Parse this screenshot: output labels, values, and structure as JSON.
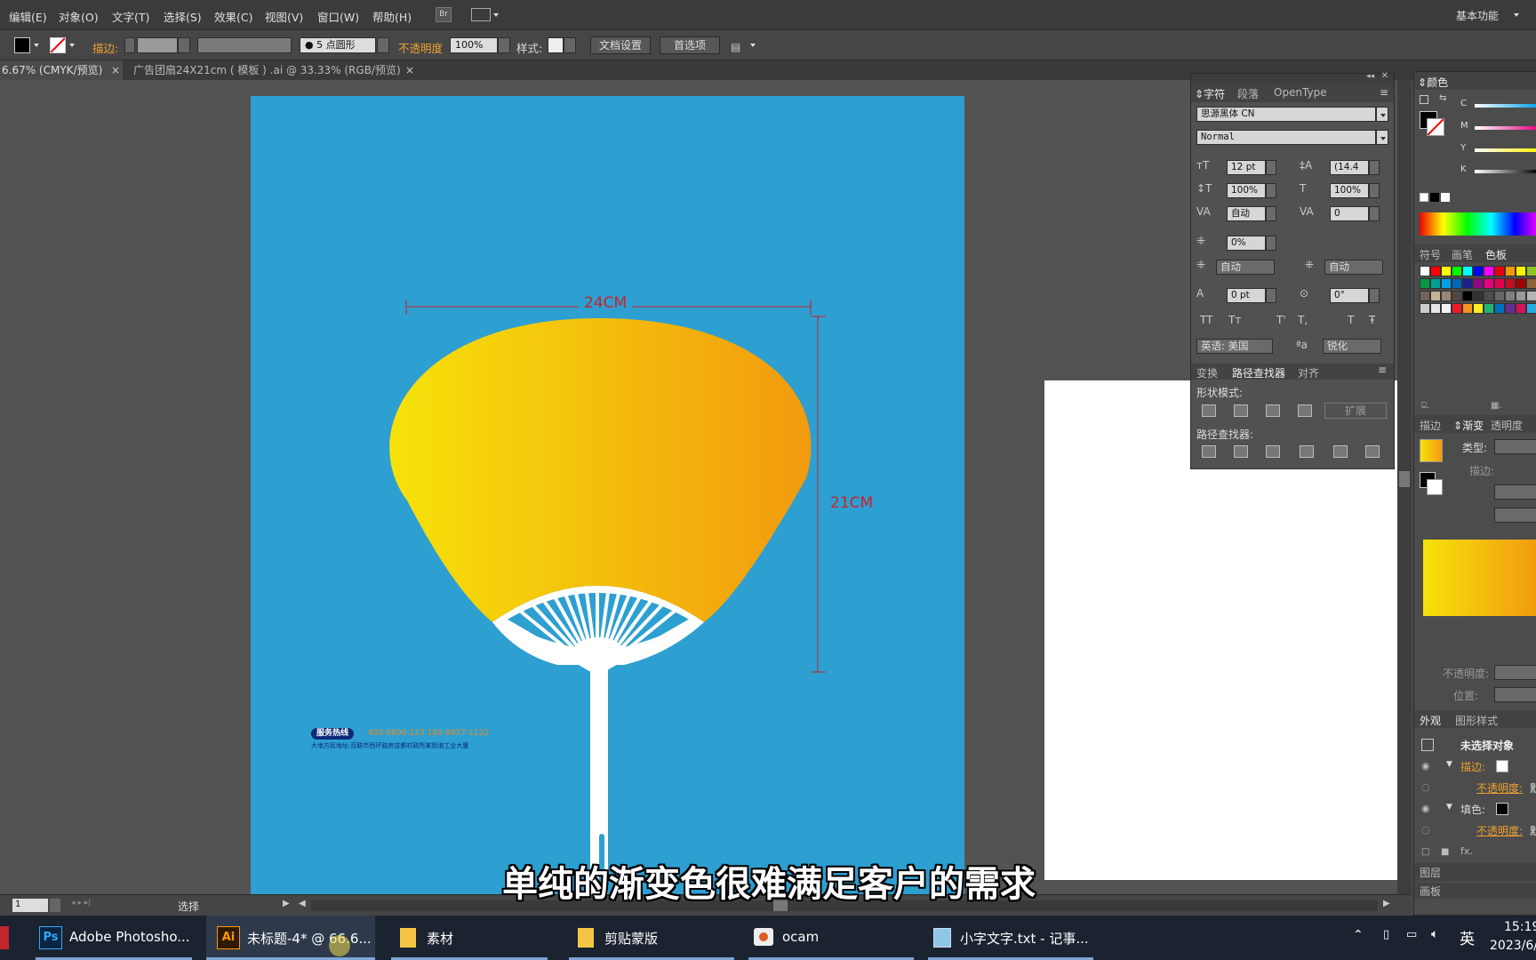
{
  "menu": {
    "items": [
      "编辑(E)",
      "对象(O)",
      "文字(T)",
      "选择(S)",
      "效果(C)",
      "视图(V)",
      "窗口(W)",
      "帮助(H)"
    ],
    "bridge_label": "Br",
    "workspace": "基本功能"
  },
  "control": {
    "stroke_label": "描边:",
    "brush_label": "5 点圆形",
    "opacity_label": "不透明度",
    "opacity_value": "100%",
    "style_label": "样式:",
    "doc_setup": "文档设置",
    "preferences": "首选项"
  },
  "tabs": [
    {
      "label": "6.67% (CMYK/预览)"
    },
    {
      "label": "广告团扇24X21cm ( 模板 ) .ai @ 33.33% (RGB/预览)"
    }
  ],
  "artwork": {
    "width_label": "24CM",
    "height_label": "21CM",
    "hotline_badge": "服务热线",
    "hotline_numbers": "400-6800-123   180-8877-1122",
    "address": "大地方民地址:百联市西环路房这都村政所某街道工业大厦",
    "colors": {
      "background": "#2d9fd1",
      "gradient_start": "#f6e20a",
      "gradient_end": "#f29a0e",
      "dimension": "#c8222a"
    }
  },
  "char_panel": {
    "tabs": [
      "字符",
      "段落",
      "OpenType"
    ],
    "font": "思源黑体 CN",
    "style": "Normal",
    "size": "12 pt",
    "leading": "(14.4",
    "vscale": "100%",
    "hscale": "100%",
    "kerning": "自动",
    "tracking": "0",
    "tsume": "0%",
    "aki_left": "自动",
    "aki_right": "自动",
    "baseline": "0 pt",
    "rotation": "0°",
    "language": "英语: 美国",
    "aa_method": "锐化"
  },
  "pathfinder": {
    "tabs": [
      "变换",
      "路径查找器",
      "对齐"
    ],
    "shape_modes": "形状模式:",
    "expand": "扩展",
    "pathfinders": "路径查找器:"
  },
  "color_panel": {
    "title": "颜色",
    "channels": [
      "C",
      "M",
      "Y",
      "K"
    ],
    "swatch_tabs": [
      "符号",
      "画笔",
      "色板"
    ],
    "swatches": [
      "#ffffff",
      "#ff0000",
      "#ffff00",
      "#00ff00",
      "#00ffff",
      "#0000ff",
      "#ff00ff",
      "#e60012",
      "#f39800",
      "#fff100",
      "#8fc31f",
      "#009944",
      "#009e96",
      "#00a0e9",
      "#0068b7",
      "#1d2088",
      "#920783",
      "#e4007f",
      "#e5004f",
      "#c30d23",
      "#a40000",
      "#8c6239",
      "#736357",
      "#c7b299",
      "#998675",
      "#534741",
      "#000000",
      "#333333",
      "#4d4d4d",
      "#666666",
      "#808080",
      "#999999",
      "#b3b3b3",
      "#cccccc",
      "#e6e6e6",
      "#f2f2f2",
      "#ed1c24",
      "#f7931e",
      "#fcee21",
      "#22b573",
      "#0071bc",
      "#662d91",
      "#d4145a",
      "#29abe2"
    ]
  },
  "gradient_panel": {
    "tabs": [
      "描边",
      "渐变",
      "透明度"
    ],
    "type_label": "类型:",
    "stroke_label": "描边:",
    "opacity_label": "不透明度:",
    "position_label": "位置:"
  },
  "appearance": {
    "tabs": [
      "外观",
      "图形样式"
    ],
    "title": "未选择对象",
    "stroke": "描边:",
    "opacity1": "不透明度:",
    "fill": "填色:",
    "opacity2": "不透明度:",
    "opacity_value": "默"
  },
  "layers": {
    "label": "图层"
  },
  "artboards": {
    "label": "画板"
  },
  "status": {
    "zoom": "1",
    "tool": "选择"
  },
  "subtitle": "单纯的渐变色很难满足客户的需求",
  "taskbar": {
    "apps": [
      "Adobe Photosho...",
      "未标题-4* @ 66.6...",
      "素材",
      "剪贴蒙版",
      "ocam",
      "小字文字.txt - 记事..."
    ],
    "clock": "15:19",
    "date": "2023/6/",
    "ime": "英"
  }
}
